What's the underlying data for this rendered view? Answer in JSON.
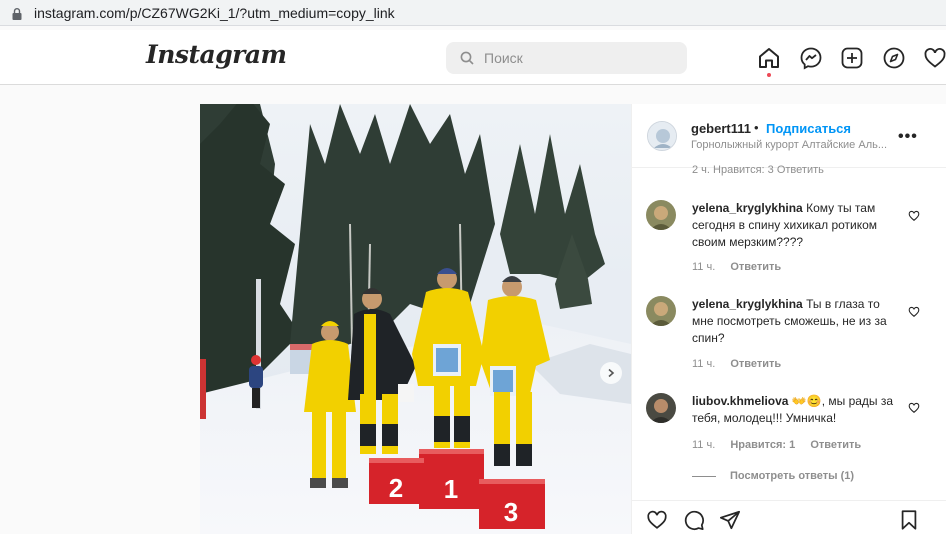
{
  "browser": {
    "url": "instagram.com/p/CZ67WG2Ki_1/?utm_medium=copy_link"
  },
  "header": {
    "logo": "Instagram",
    "search_placeholder": "Поиск",
    "nav_icons": [
      "home-icon",
      "messenger-icon",
      "new-post-icon",
      "explore-icon",
      "activity-heart-icon"
    ]
  },
  "post": {
    "username": "gebert111",
    "separator": "•",
    "follow_label": "Подписаться",
    "location": "Горнолыжный курорт Алтайские Аль...",
    "more_label": "•••",
    "clipped_meta": "2 ч.    Нравится: 3    Ответить",
    "podium": [
      "2",
      "1",
      "3"
    ],
    "comments": [
      {
        "user": "yelena_kryglykhina",
        "text": "Кому ты там сегодня в спину хихикал ротиком своим мерзким????",
        "time": "11 ч.",
        "likes": "",
        "reply": "Ответить"
      },
      {
        "user": "yelena_kryglykhina",
        "text": "Ты в глаза то мне посмотреть сможешь, не из за спин?",
        "time": "11 ч.",
        "likes": "",
        "reply": "Ответить"
      },
      {
        "user": "liubov.khmeliova",
        "text": "👐😊, мы рады за тебя, молодец!!! Умничка!",
        "time": "11 ч.",
        "likes": "Нравится: 1",
        "reply": "Ответить"
      }
    ],
    "view_replies": "Посмотреть ответы (1)"
  },
  "colors": {
    "accent": "#0095f6",
    "notification": "#ed4956",
    "uniform": "#f2d000"
  }
}
